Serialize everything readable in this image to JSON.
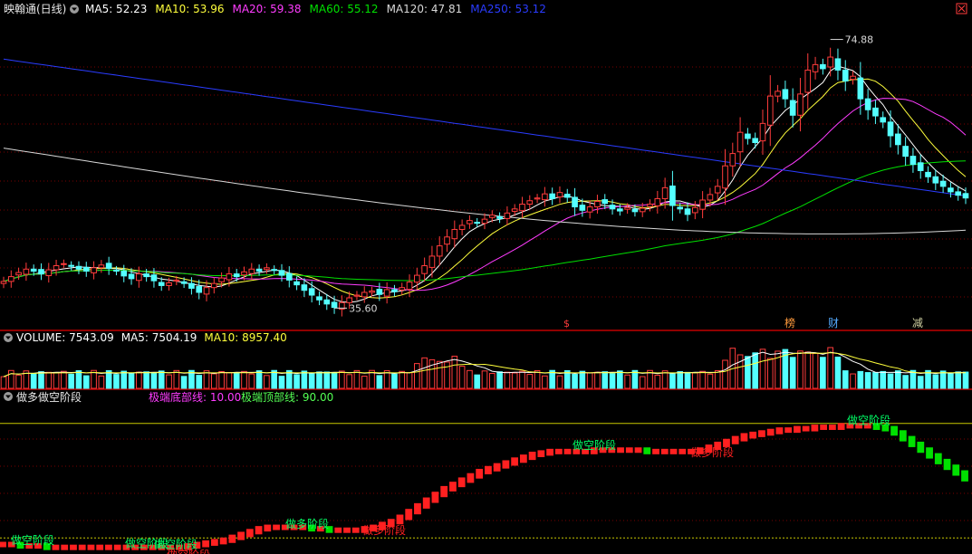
{
  "window": {
    "stock_name": "映翰通",
    "period": "(日线)"
  },
  "colors": {
    "up": "#ff3c3c",
    "down": "#54ffff",
    "ma5": "#ffffff",
    "ma10": "#ffff3c",
    "ma20": "#ff3cff",
    "ma60": "#00e000",
    "ma120": "#d8d8d8",
    "ma250": "#2a3cff",
    "divider": "#c00000",
    "grid": "#7a0000",
    "bull": "#ff2020",
    "bear": "#00e000"
  },
  "price_panel": {
    "legend": [
      {
        "label": "MA5: 52.23",
        "color_key": "ma5"
      },
      {
        "label": "MA10: 53.96",
        "color_key": "ma10"
      },
      {
        "label": "MA20: 59.38",
        "color_key": "ma20"
      },
      {
        "label": "MA60: 55.12",
        "color_key": "ma60"
      },
      {
        "label": "MA120: 47.81",
        "color_key": "ma120"
      },
      {
        "label": "MA250: 53.12",
        "color_key": "ma250"
      }
    ],
    "high_marker": "74.88",
    "low_marker": "35.60",
    "event_markers": [
      "$",
      "榜",
      "财",
      "减"
    ]
  },
  "volume_panel": {
    "legend": [
      {
        "label": "VOLUME: 7543.09",
        "color_key": "ma5"
      },
      {
        "label": "MA5: 7504.19",
        "color_key": "ma5"
      },
      {
        "label": "MA10: 8957.40",
        "color_key": "ma10"
      }
    ]
  },
  "indicator_panel": {
    "title": "做多做空阶段",
    "bottom_line_label": "极端底部线: 10.00",
    "top_line_label": "极端顶部线: 90.00",
    "stage_labels": [
      "做空阶段",
      "做空阶段",
      "做空阶段",
      "做多阶段",
      "做空阶段",
      "做多阶段",
      "做空阶段",
      "做多阶段",
      "做空阶段"
    ]
  },
  "chart_data": [
    {
      "type": "candlestick",
      "title": "映翰通 (日线)",
      "ylim": [
        33,
        78
      ],
      "high": 74.88,
      "low": 35.6,
      "ma_latest": {
        "MA5": 52.23,
        "MA10": 53.96,
        "MA20": 59.38,
        "MA60": 55.12,
        "MA120": 47.81,
        "MA250": 53.12
      },
      "close_series": [
        39.5,
        40.2,
        40.8,
        41.3,
        41.0,
        40.6,
        41.2,
        41.8,
        42.1,
        41.7,
        41.3,
        41.0,
        41.5,
        41.9,
        41.4,
        41.0,
        40.3,
        39.9,
        40.6,
        40.2,
        39.6,
        38.9,
        39.3,
        39.7,
        39.2,
        38.5,
        37.9,
        38.6,
        39.2,
        40.0,
        40.6,
        40.2,
        40.9,
        41.3,
        41.0,
        41.5,
        41.1,
        40.4,
        39.7,
        39.0,
        38.2,
        37.5,
        36.8,
        36.2,
        35.7,
        36.4,
        37.1,
        37.5,
        37.9,
        38.1,
        37.6,
        38.3,
        38.0,
        38.6,
        39.4,
        40.4,
        41.8,
        43.2,
        44.7,
        46.0,
        47.1,
        47.7,
        48.4,
        48.0,
        48.6,
        49.2,
        48.7,
        49.5,
        50.1,
        50.8,
        51.3,
        51.7,
        52.3,
        51.6,
        52.5,
        51.8,
        50.4,
        49.9,
        50.4,
        51.2,
        50.9,
        50.1,
        49.8,
        50.3,
        49.7,
        50.2,
        50.8,
        51.6,
        53.2,
        50.6,
        50.1,
        49.3,
        50.3,
        51.4,
        52.2,
        53.4,
        56.4,
        58.2,
        61.3,
        60.4,
        59.8,
        62.6,
        66.6,
        67.3,
        66.2,
        63.8,
        66.9,
        70.4,
        71.2,
        70.6,
        72.3,
        70.4,
        68.8,
        69.5,
        66.2,
        64.6,
        63.7,
        62.8,
        60.8,
        59.5,
        57.8,
        56.6,
        55.7,
        54.8,
        53.9,
        53.4,
        52.6,
        52.1,
        51.7
      ]
    },
    {
      "type": "bar",
      "title": "VOLUME",
      "series": [
        {
          "name": "VOLUME",
          "latest": 7543.09
        }
      ],
      "ma": {
        "MA5": 7504.19,
        "MA10": 8957.4
      }
    },
    {
      "type": "area",
      "title": "做多做空阶段",
      "ylim": [
        0,
        100
      ],
      "reference_lines": {
        "bottom": 10.0,
        "top": 90.0
      },
      "values": [
        6,
        6,
        5,
        5,
        5,
        4,
        4,
        4,
        4,
        4,
        4,
        4,
        4,
        4,
        4,
        4,
        4,
        4,
        4,
        4,
        4,
        5,
        6,
        7,
        8,
        9,
        11,
        13,
        15,
        17,
        18,
        18,
        18,
        18,
        18,
        17,
        17,
        16,
        16,
        16,
        16,
        17,
        18,
        20,
        22,
        25,
        29,
        33,
        37,
        41,
        45,
        48,
        51,
        54,
        57,
        59,
        61,
        63,
        65,
        67,
        69,
        70,
        71,
        71,
        71,
        71,
        71,
        72,
        72,
        72,
        72,
        72,
        72,
        71,
        71,
        71,
        71,
        71,
        71,
        72,
        74,
        76,
        78,
        80,
        82,
        83,
        84,
        85,
        86,
        86,
        87,
        87,
        88,
        88,
        88,
        89,
        89,
        89,
        89,
        88,
        87,
        84,
        80,
        76,
        72,
        68,
        64,
        60,
        56,
        52
      ]
    }
  ]
}
